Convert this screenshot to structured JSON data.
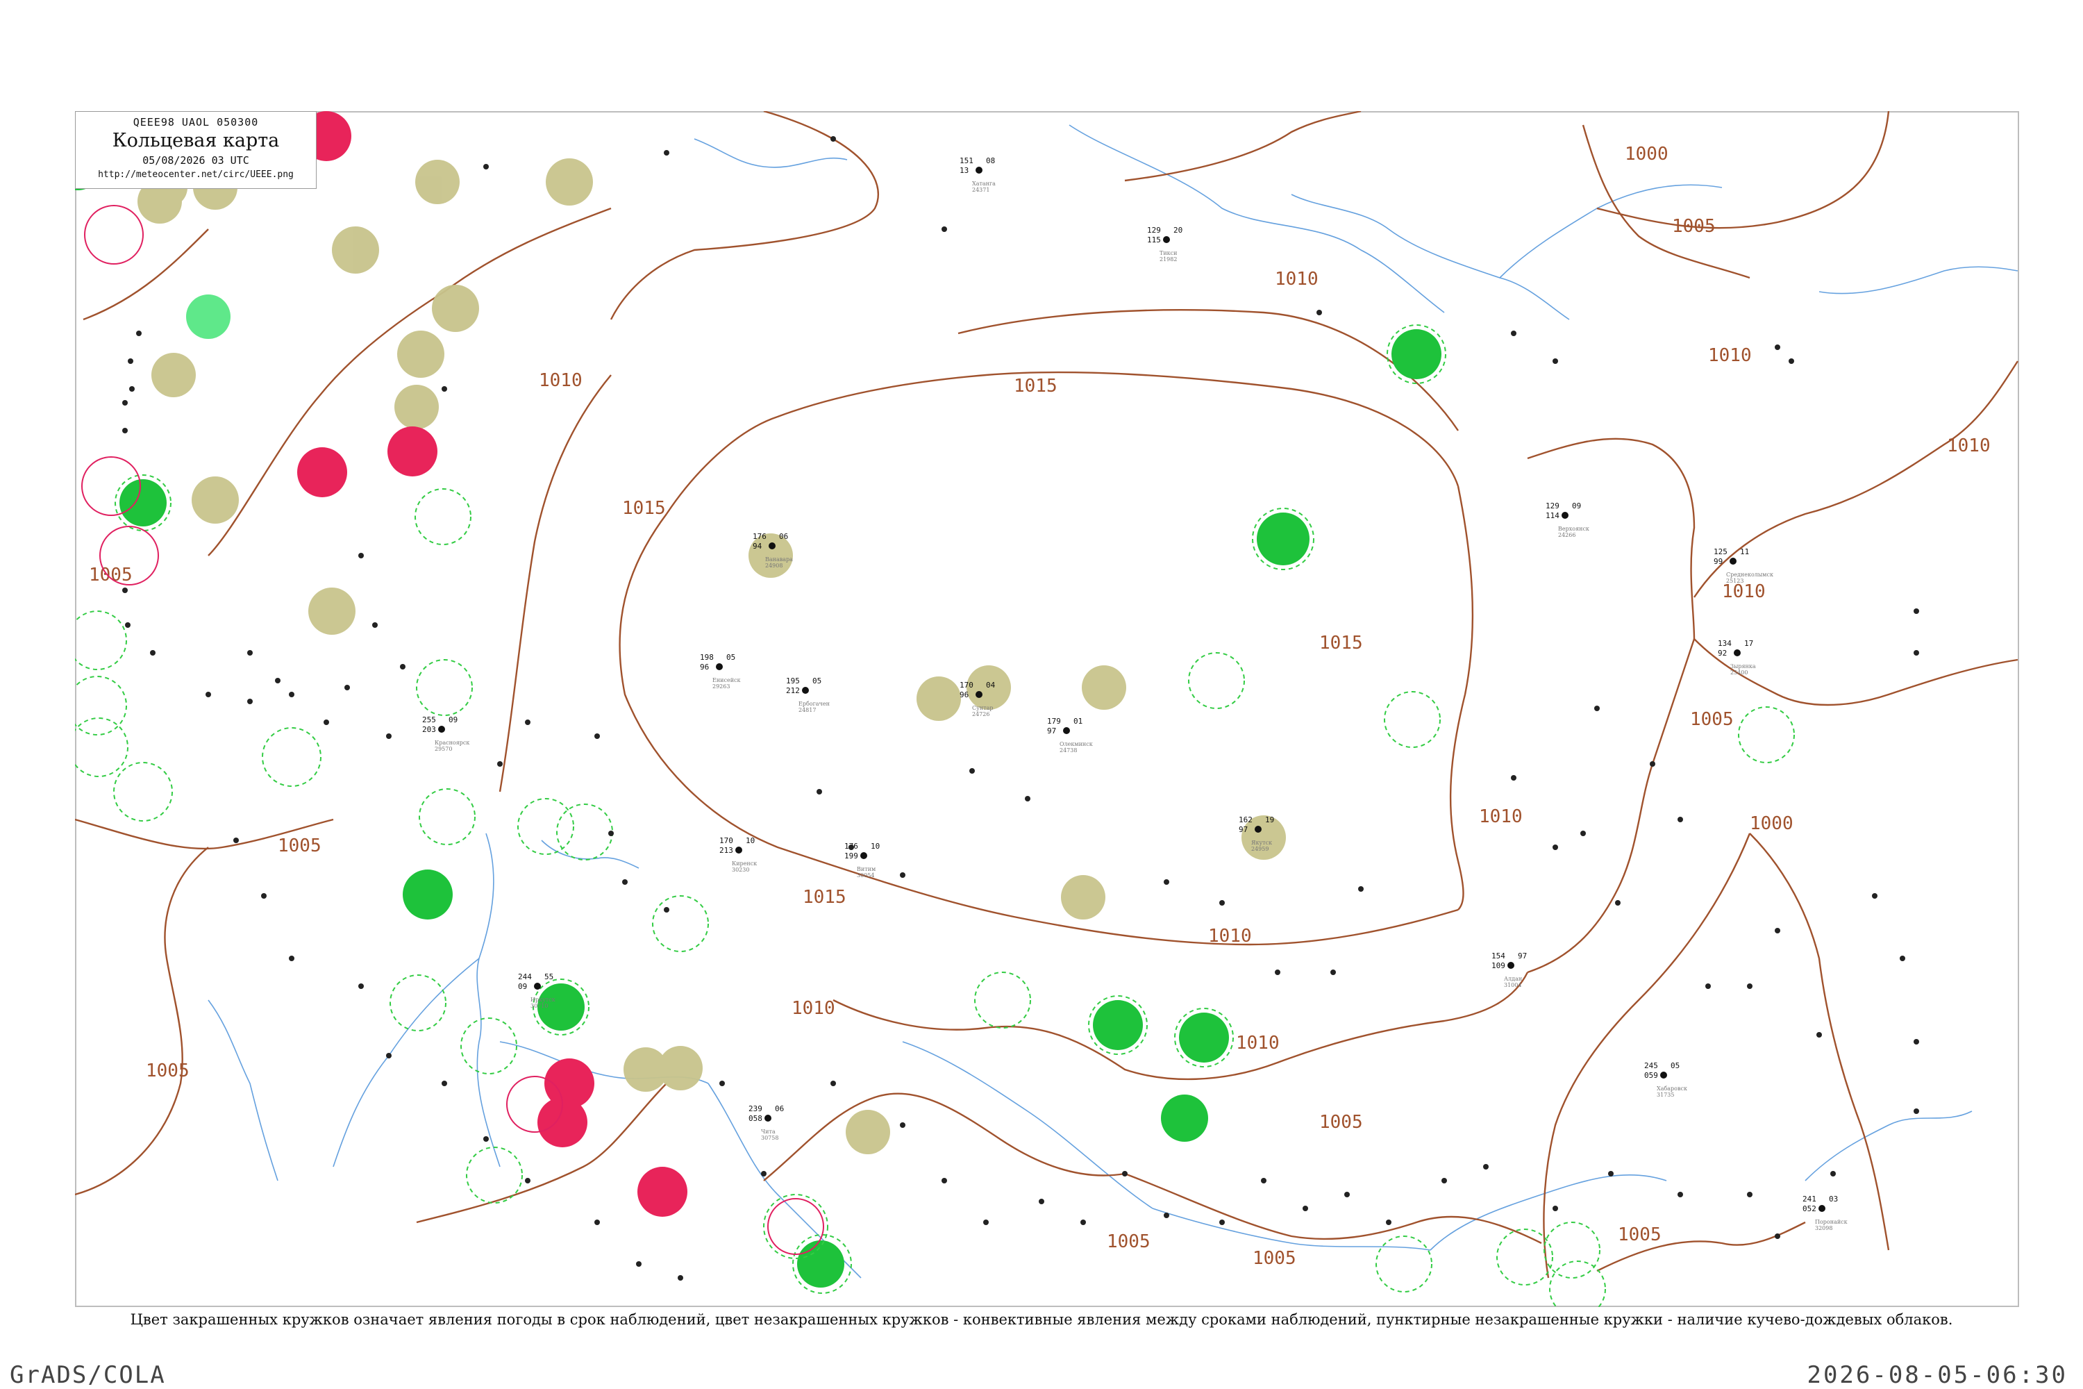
{
  "header": {
    "codes": "QEEE98  UAOL  050300",
    "title": "Кольцевая карта",
    "datetime": "05/08/2026 03 UTC",
    "url": "http://meteocenter.net/circ/UEEE.png"
  },
  "caption": "Цвет закрашенных кружков означает явления погоды в срок наблюдений, цвет незакрашенных кружков - конвективные явления между сроками наблюдений, пунктирные незакрашенные кружки - наличие кучево-дождевых облаков.",
  "footer": {
    "producer": "GrADS/COLA",
    "timestamp": "2026-08-05-06:30"
  },
  "isobar_labels": [
    "1000",
    "1005",
    "1010",
    "1015"
  ],
  "colors": {
    "isobar": "#a0522d",
    "rivers": "#4a90d9",
    "coast": "#6aa7e0",
    "thunder_fill": "#e8245a",
    "rain_fill": "#1ec23b",
    "shower_fill": "#5fe88a",
    "fog_fill": "#c8c48c",
    "cb_dashed": "#33cc44",
    "convective_ring": "#e02060"
  },
  "stations": [
    {
      "id": "24371",
      "name": "Хатанга",
      "p": "151",
      "t": "13",
      "td": "08"
    },
    {
      "id": "21982",
      "name": "Тикси",
      "p": "129",
      "t": "115",
      "td": "20"
    },
    {
      "id": "24908",
      "name": "Ванавара",
      "p": "176",
      "t": "94",
      "td": "06"
    },
    {
      "id": "24817",
      "name": "Ербогачен",
      "p": "195",
      "t": "212",
      "td": "05"
    },
    {
      "id": "24726",
      "name": "Сунтар",
      "p": "170",
      "t": "96",
      "td": "04"
    },
    {
      "id": "24738",
      "name": "Олекминск",
      "p": "179",
      "t": "97",
      "td": "01"
    },
    {
      "id": "24959",
      "name": "Якутск",
      "p": "162",
      "t": "97",
      "td": "19"
    },
    {
      "id": "24266",
      "name": "Верхоянск",
      "p": "129",
      "t": "114",
      "td": "09"
    },
    {
      "id": "25123",
      "name": "Среднеколымск",
      "p": "125",
      "t": "99",
      "td": "11"
    },
    {
      "id": "25400",
      "name": "Зырянка",
      "p": "134",
      "t": "92",
      "td": "17"
    },
    {
      "id": "31004",
      "name": "Алдан",
      "p": "154",
      "t": "109",
      "td": "97"
    },
    {
      "id": "30054",
      "name": "Витим",
      "p": "176",
      "t": "199",
      "td": "10"
    },
    {
      "id": "30230",
      "name": "Киренск",
      "p": "170",
      "t": "213",
      "td": "10"
    },
    {
      "id": "29263",
      "name": "Енисейск",
      "p": "198",
      "t": "96",
      "td": "05"
    },
    {
      "id": "29570",
      "name": "Красноярск",
      "p": "255",
      "t": "203",
      "td": "09"
    },
    {
      "id": "30710",
      "name": "Иркутск",
      "p": "244",
      "t": "09",
      "td": "55"
    },
    {
      "id": "30758",
      "name": "Чита",
      "p": "239",
      "t": "058",
      "td": "06"
    },
    {
      "id": "31735",
      "name": "Хабаровск",
      "p": "245",
      "t": "059",
      "td": "05"
    },
    {
      "id": "32098",
      "name": "Поронайск",
      "p": "241",
      "t": "052",
      "td": "03"
    }
  ]
}
